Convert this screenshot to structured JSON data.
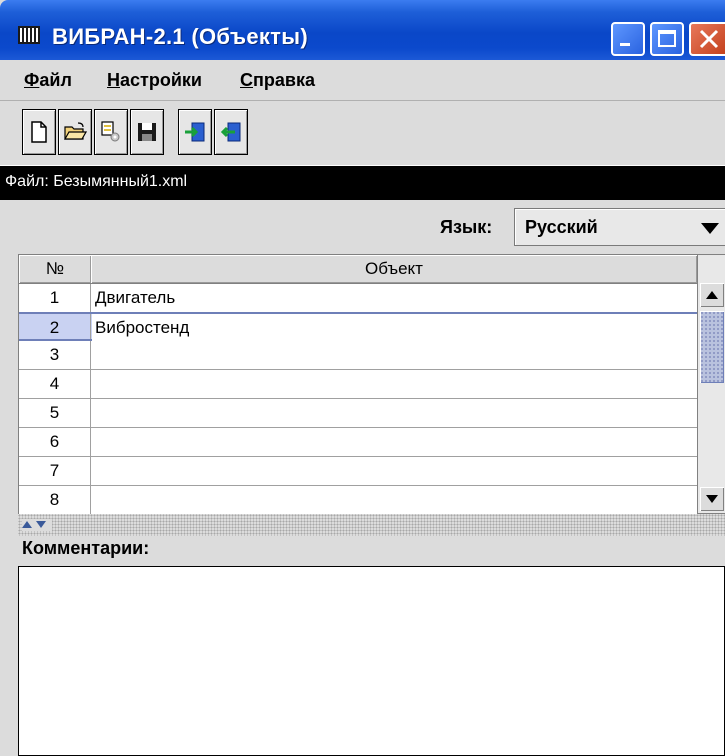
{
  "window": {
    "title": "ВИБРАН-2.1 (Объекты)",
    "title_color": "#0a47c8"
  },
  "titlebar_buttons": {
    "minimize_icon": "minimize-icon",
    "maximize_icon": "maximize-icon",
    "close_icon": "close-icon"
  },
  "menu": {
    "file": {
      "hotkey": "Ф",
      "rest": "айл"
    },
    "settings": {
      "hotkey": "Н",
      "rest": "астройки"
    },
    "help": {
      "hotkey": "С",
      "rest": "правка"
    }
  },
  "toolbar": {
    "icons": [
      "new-document-icon",
      "open-folder-icon",
      "properties-icon",
      "save-icon",
      "import-icon",
      "export-icon"
    ]
  },
  "file_path": "Файл: Безымянный1.xml",
  "language": {
    "label": "Язык:",
    "selected": "Русский"
  },
  "table": {
    "columns": [
      "№",
      "Объект"
    ],
    "rows": [
      {
        "num": "1",
        "object": "Двигатель"
      },
      {
        "num": "2",
        "object": "Вибростенд"
      },
      {
        "num": "3",
        "object": ""
      },
      {
        "num": "4",
        "object": ""
      },
      {
        "num": "5",
        "object": ""
      },
      {
        "num": "6",
        "object": ""
      },
      {
        "num": "7",
        "object": ""
      },
      {
        "num": "8",
        "object": ""
      }
    ],
    "selected_row": 2
  },
  "comments": {
    "label": "Комментарии:",
    "value": ""
  }
}
